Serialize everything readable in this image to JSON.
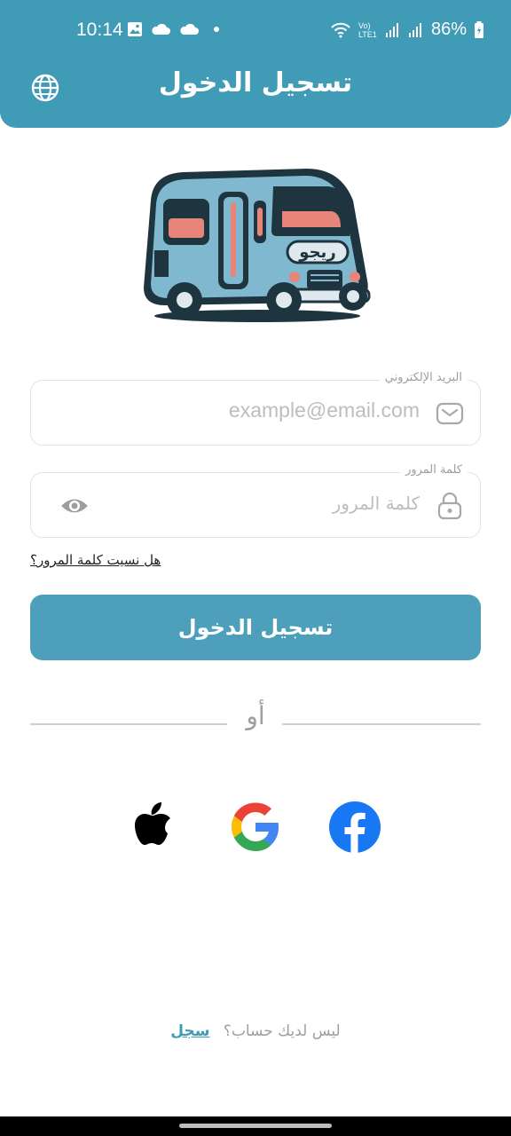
{
  "status_bar": {
    "time": "10:14",
    "battery": "86%",
    "network": "Vo) LTE1"
  },
  "header": {
    "title": "تسجيل الدخول",
    "language_icon": "globe-icon"
  },
  "logo": {
    "text": "ريجو"
  },
  "email_field": {
    "label": "البريد الإلكتروني",
    "placeholder": "example@email.com",
    "icon": "envelope-icon"
  },
  "password_field": {
    "label": "كلمة المرور",
    "placeholder": "كلمة المرور",
    "icon": "lock-icon",
    "toggle_icon": "eye-icon"
  },
  "forgot_password": "هل نسيت كلمة المرور؟",
  "login_button": "تسجيل الدخول",
  "divider_text": "أو",
  "social": [
    {
      "name": "apple",
      "icon": "apple-icon"
    },
    {
      "name": "google",
      "icon": "google-icon"
    },
    {
      "name": "facebook",
      "icon": "facebook-icon"
    }
  ],
  "signup": {
    "prompt": "ليس لديك حساب؟",
    "link": "سجل"
  },
  "colors": {
    "primary": "#3f9bb6",
    "button": "#4d9fbb",
    "placeholder": "#bdbdbd"
  }
}
